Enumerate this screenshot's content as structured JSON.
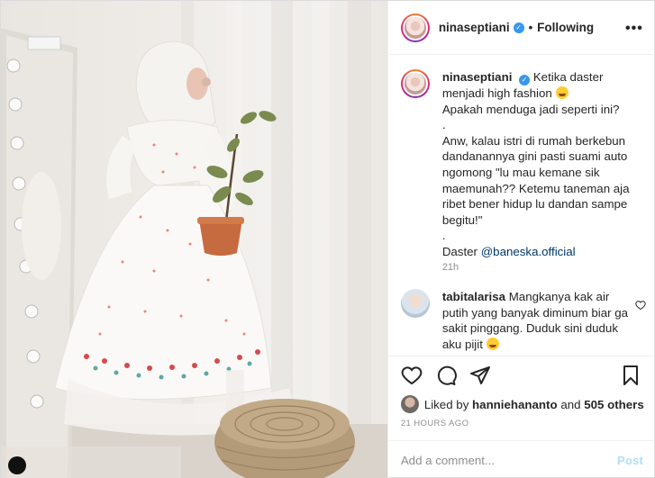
{
  "post": {
    "username": "ninaseptiani",
    "verified_mark": "✓",
    "dot": "•",
    "follow_state": "Following",
    "more_label": "•••"
  },
  "caption": {
    "username": "ninaseptiani",
    "lines": [
      "Ketika daster",
      "menjadi high fashion",
      "Apakah menduga jadi seperti ini?",
      ".",
      "Anw, kalau istri di rumah berkebun",
      "dandanannya gini pasti suami auto",
      "ngomong \"lu mau kemane sik",
      "maemunah?? Ketemu taneman aja",
      "ribet bener hidup lu dandan sampe",
      "begitu!\"",
      ".",
      "Daster"
    ],
    "mention": "@baneska.official",
    "time": "21h"
  },
  "comment": {
    "username": "tabitalarisa",
    "text": "Mangkanya kak air putih yang banyak diminum biar ga sakit pinggang. Duduk sini duduk aku pijit"
  },
  "likes": {
    "prefix": "Liked by",
    "user": "hanniehananto",
    "connector": "and",
    "others": "505 others"
  },
  "timestamp": "21 HOURS AGO",
  "add_comment": {
    "placeholder": "Add a comment...",
    "post_label": "Post"
  },
  "icons": {
    "like": "heart-icon",
    "comment": "comment-icon",
    "share": "share-icon",
    "save": "bookmark-icon",
    "more": "more-icon",
    "verified": "verified-badge-icon"
  },
  "colors": {
    "verified_blue": "#3897f0",
    "link": "#00376b",
    "muted": "#8e8e8e",
    "post_disabled": "#b2dffc",
    "border": "#dbdbdb"
  }
}
